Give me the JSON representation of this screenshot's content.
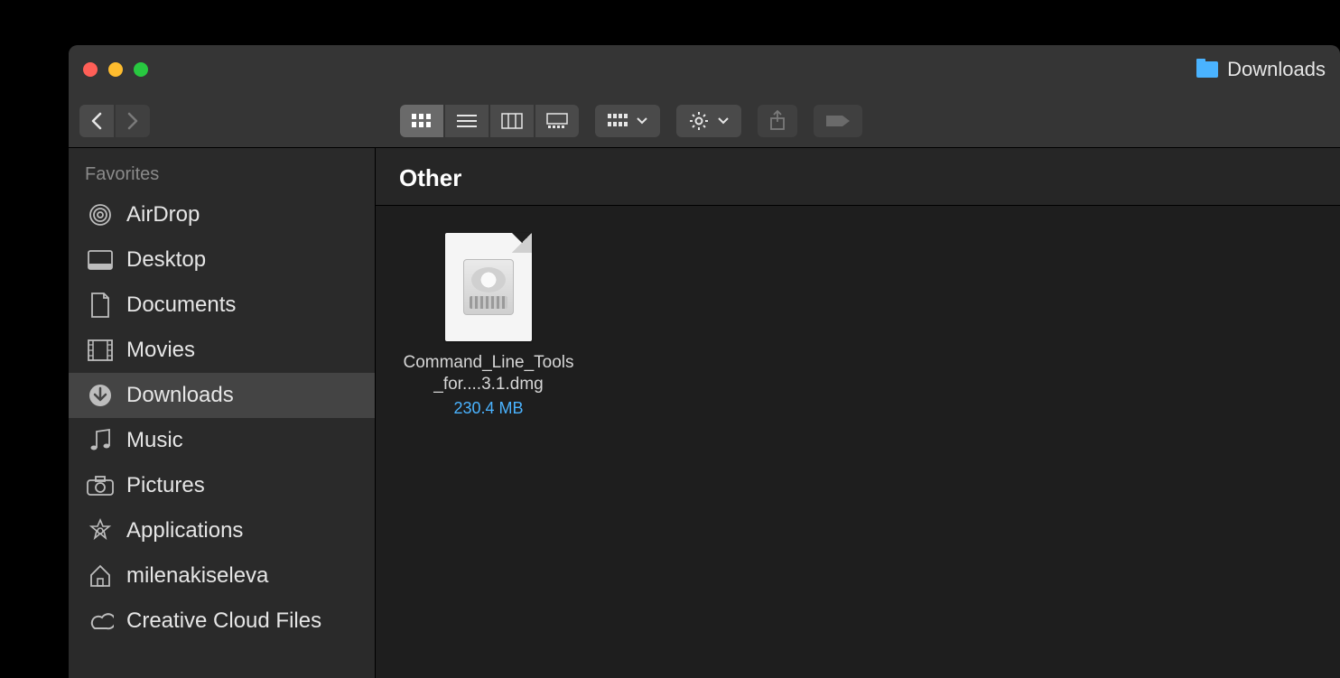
{
  "window": {
    "title": "Downloads"
  },
  "toolbar": {
    "view_modes": [
      "icon",
      "list",
      "column",
      "gallery"
    ],
    "active_view": "icon"
  },
  "sidebar": {
    "heading": "Favorites",
    "items": [
      {
        "icon": "airdrop-icon",
        "label": "AirDrop"
      },
      {
        "icon": "desktop-icon",
        "label": "Desktop"
      },
      {
        "icon": "documents-icon",
        "label": "Documents"
      },
      {
        "icon": "movies-icon",
        "label": "Movies"
      },
      {
        "icon": "downloads-icon",
        "label": "Downloads",
        "selected": true
      },
      {
        "icon": "music-icon",
        "label": "Music"
      },
      {
        "icon": "pictures-icon",
        "label": "Pictures"
      },
      {
        "icon": "applications-icon",
        "label": "Applications"
      },
      {
        "icon": "home-icon",
        "label": "milenakiseleva"
      },
      {
        "icon": "creative-cloud-icon",
        "label": "Creative Cloud Files"
      }
    ]
  },
  "main": {
    "section_header": "Other",
    "files": [
      {
        "name": "Command_Line_Tools_for....3.1.dmg",
        "size": "230.4 MB"
      }
    ]
  }
}
